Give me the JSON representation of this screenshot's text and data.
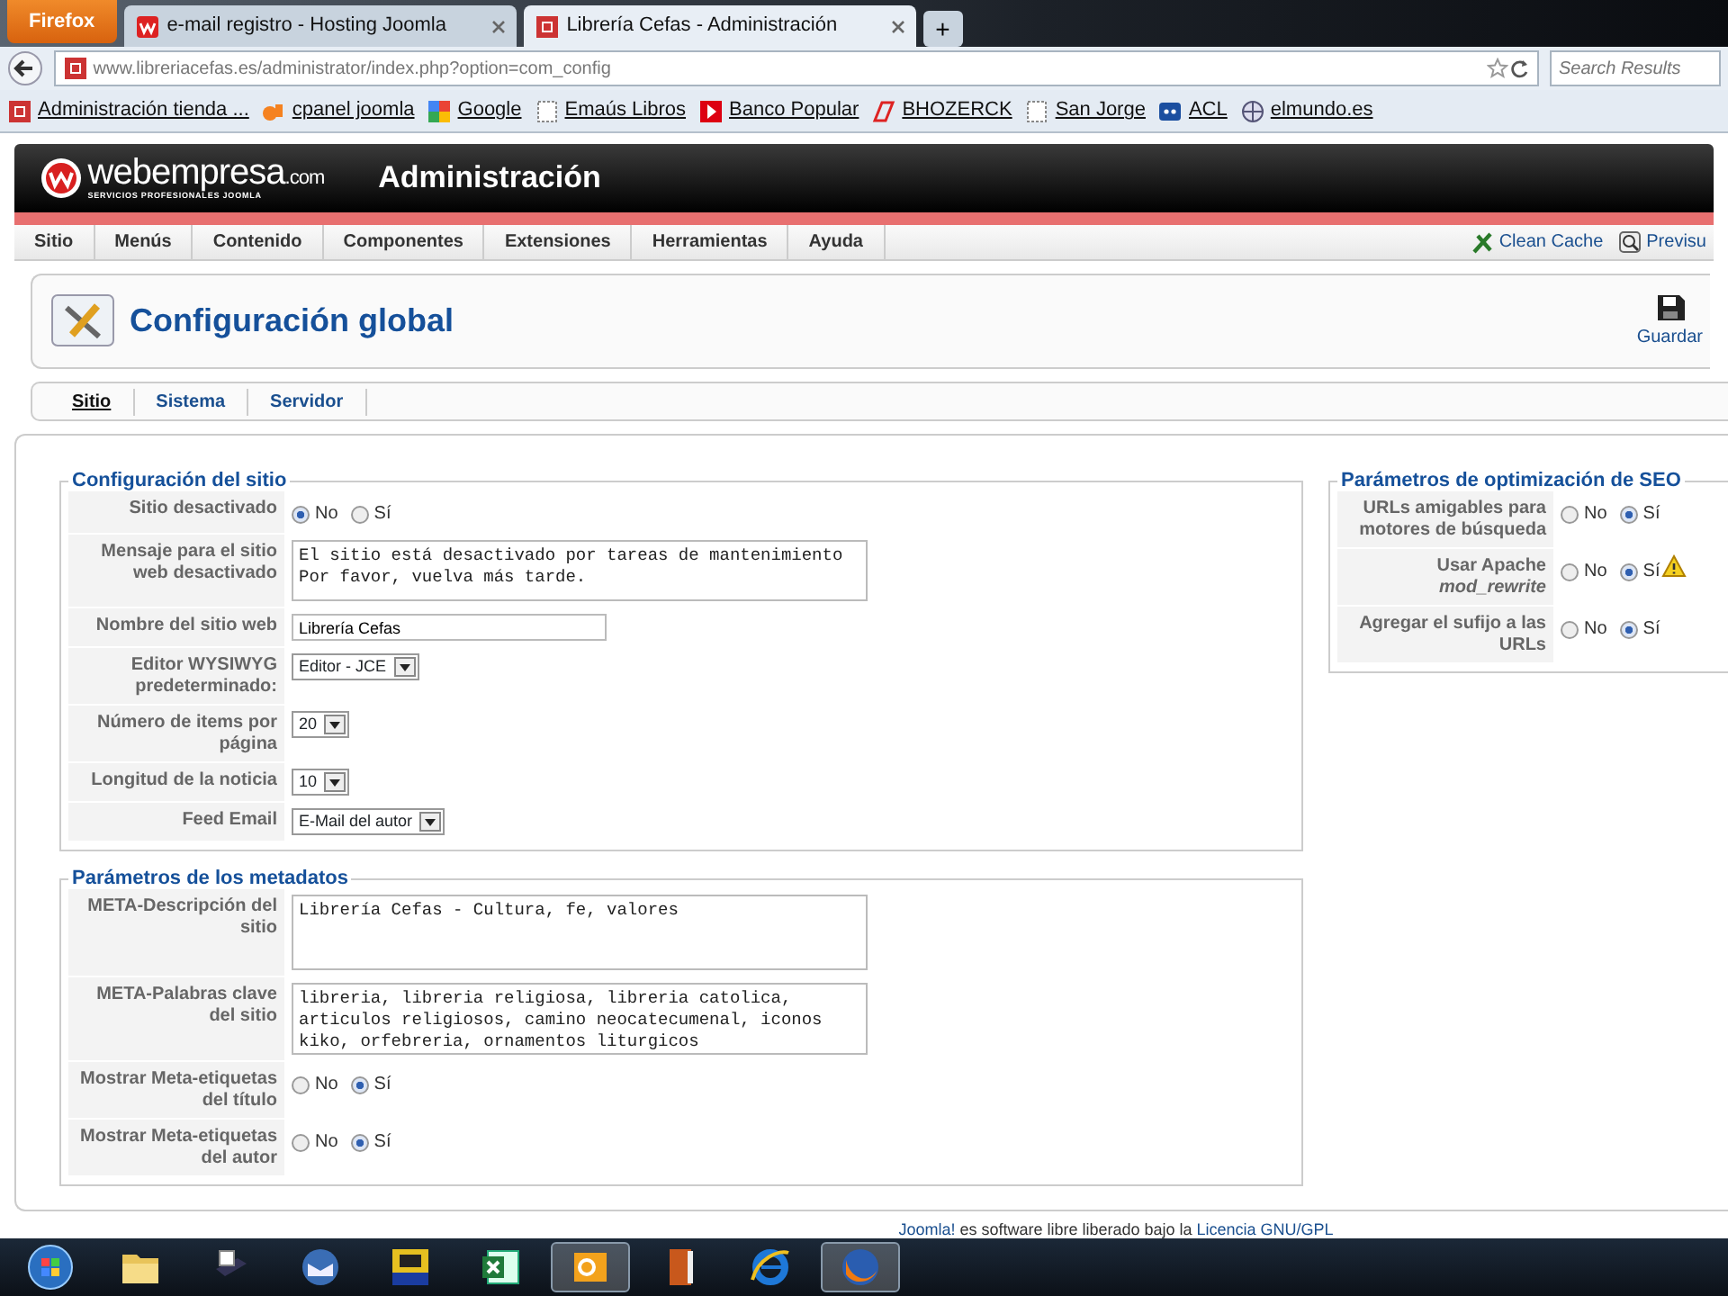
{
  "browser": {
    "menu_button": "Firefox",
    "tabs": [
      {
        "label": "e-mail registro - Hosting Joomla",
        "selected": false,
        "kind": "webempresa"
      },
      {
        "label": "Librería Cefas - Administración",
        "selected": true,
        "kind": "joomla"
      }
    ],
    "new_tab": "+",
    "address": "www.libreriacefas.es/administrator/index.php?option=com_config",
    "search_placeholder": "Search Results",
    "bookmarks": [
      {
        "label": "Administración tienda ...",
        "kind": "joomla"
      },
      {
        "label": "cpanel joomla",
        "kind": "cpanel"
      },
      {
        "label": "Google",
        "kind": "google"
      },
      {
        "label": "Emaús Libros",
        "kind": "page"
      },
      {
        "label": "Banco Popular",
        "kind": "banco"
      },
      {
        "label": "BHOZERCK",
        "kind": "bhozerck"
      },
      {
        "label": "San Jorge",
        "kind": "page"
      },
      {
        "label": "ACL",
        "kind": "acl"
      },
      {
        "label": "elmundo.es",
        "kind": "globe"
      }
    ]
  },
  "header": {
    "logo": "webempresa",
    "logo_suffix": ".com",
    "tagline": "SERVICIOS PROFESIONALES JOOMLA",
    "title": "Administración"
  },
  "menu": {
    "items": [
      "Sitio",
      "Menús",
      "Contenido",
      "Componentes",
      "Extensiones",
      "Herramientas",
      "Ayuda"
    ],
    "actions": [
      {
        "label": "Clean Cache",
        "kind": "broom"
      },
      {
        "label": "Previsu",
        "kind": "preview"
      }
    ]
  },
  "page_title": "Configuración global",
  "save_button": "Guardar",
  "subtabs": [
    {
      "label": "Sitio",
      "selected": true
    },
    {
      "label": "Sistema",
      "selected": false
    },
    {
      "label": "Servidor",
      "selected": false
    }
  ],
  "left_sections": [
    {
      "title": "Configuración del sitio",
      "rows": [
        {
          "kind": "radio",
          "label": "Sitio desactivado",
          "options": [
            {
              "label": "No",
              "selected": true
            },
            {
              "label": "Sí",
              "selected": false
            }
          ]
        },
        {
          "kind": "textarea",
          "label": "Mensaje para el sitio web desactivado",
          "value": "El sitio está desactivado por tareas de mantenimiento\nPor favor, vuelva más tarde."
        },
        {
          "kind": "text",
          "label": "Nombre del sitio web",
          "value": "Librería Cefas"
        },
        {
          "kind": "select",
          "label": "Editor WYSIWYG predeterminado:",
          "value": "Editor - JCE"
        },
        {
          "kind": "select",
          "label": "Número de items por página",
          "value": "20"
        },
        {
          "kind": "select",
          "label": "Longitud de la noticia",
          "value": "10"
        },
        {
          "kind": "select",
          "label": "Feed Email",
          "value": "E-Mail del autor"
        }
      ]
    },
    {
      "title": "Parámetros de los metadatos",
      "rows": [
        {
          "kind": "textarea",
          "label": "META-Descripción del sitio",
          "value": "Librería Cefas - Cultura, fe, valores"
        },
        {
          "kind": "textarea",
          "label": "META-Palabras clave del sitio",
          "value": "libreria, libreria religiosa, libreria catolica,\narticulos religiosos, camino neocatecumenal, iconos\nkiko, orfebreria, ornamentos liturgicos"
        },
        {
          "kind": "radio",
          "label": "Mostrar Meta-etiquetas del título",
          "options": [
            {
              "label": "No",
              "selected": false
            },
            {
              "label": "Sí",
              "selected": true
            }
          ]
        },
        {
          "kind": "radio",
          "label": "Mostrar Meta-etiquetas del autor",
          "options": [
            {
              "label": "No",
              "selected": false
            },
            {
              "label": "Sí",
              "selected": true
            }
          ]
        }
      ]
    }
  ],
  "right_sections": [
    {
      "title": "Parámetros de optimización de SEO",
      "rows": [
        {
          "kind": "radio",
          "label": "URLs amigables para motores de búsqueda",
          "options": [
            {
              "label": "No",
              "selected": false
            },
            {
              "label": "Sí",
              "selected": true
            }
          ]
        },
        {
          "kind": "radio",
          "label": "Usar Apache *mod_rewrite*",
          "warning": true,
          "options": [
            {
              "label": "No",
              "selected": false
            },
            {
              "label": "Sí",
              "selected": true
            }
          ]
        },
        {
          "kind": "radio",
          "label": "Agregar el sufijo a las URLs",
          "options": [
            {
              "label": "No",
              "selected": false
            },
            {
              "label": "Sí",
              "selected": true
            }
          ]
        }
      ]
    }
  ],
  "footer": {
    "link": "Joomla!",
    "text": " es software libre liberado bajo la ",
    "license": "Licencia GNU/GPL"
  },
  "taskbar": [
    {
      "kind": "start",
      "active": false
    },
    {
      "kind": "folder",
      "active": false
    },
    {
      "kind": "scanner",
      "active": false
    },
    {
      "kind": "mail",
      "active": false
    },
    {
      "kind": "softsl",
      "active": false
    },
    {
      "kind": "excel",
      "active": false
    },
    {
      "kind": "outlook",
      "active": true
    },
    {
      "kind": "book",
      "active": false
    },
    {
      "kind": "ie",
      "active": false
    },
    {
      "kind": "firefox",
      "active": true
    }
  ]
}
